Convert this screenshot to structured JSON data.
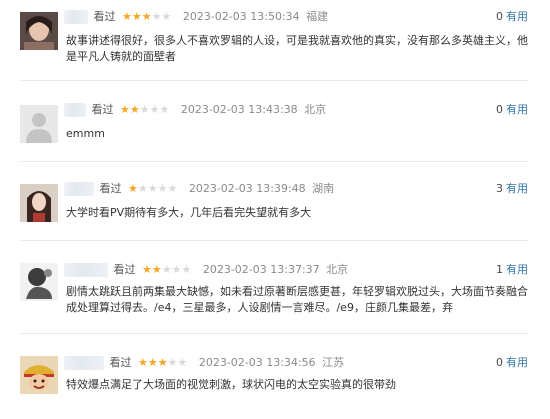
{
  "comments": [
    {
      "action": "看过",
      "stars": 3,
      "time": "2023-02-03 13:50:34",
      "location": "福建",
      "useful_count": "0",
      "useful_label": "有用",
      "text": "故事讲述得很好，很多人不喜欢罗辑的人设，可是我就喜欢他的真实，没有那么多英雄主义，他是平凡人铸就的面壁者"
    },
    {
      "action": "看过",
      "stars": 2,
      "time": "2023-02-03 13:43:38",
      "location": "北京",
      "useful_count": "0",
      "useful_label": "有用",
      "text": "emmm"
    },
    {
      "action": "看过",
      "stars": 1,
      "time": "2023-02-03 13:39:48",
      "location": "湖南",
      "useful_count": "3",
      "useful_label": "有用",
      "text": "大学时看PV期待有多大，几年后看完失望就有多大"
    },
    {
      "action": "看过",
      "stars": 2,
      "time": "2023-02-03 13:37:37",
      "location": "北京",
      "useful_count": "1",
      "useful_label": "有用",
      "text": "剧情太跳跃且前两集最大缺憾，如未看过原著断层感更甚，年轻罗辑欢脱过头，大场面节奏融合成处理算过得去。/e4，三星最多，人设剧情一言难尽。/e9，庄颜几集最差，弃"
    },
    {
      "action": "看过",
      "stars": 3,
      "time": "2023-02-03 13:34:56",
      "location": "江苏",
      "useful_count": "0",
      "useful_label": "有用",
      "text": "特效爆点满足了大场面的视觉刺激，球状闪电的太空实验真的很带劲"
    }
  ]
}
